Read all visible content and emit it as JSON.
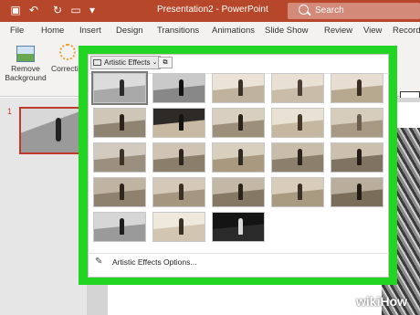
{
  "titlebar": {
    "title": "Presentation2  -  PowerPoint",
    "search_placeholder": "Search",
    "icons": [
      "save-icon",
      "undo-icon",
      "redo-icon",
      "present-icon",
      "more-icon"
    ]
  },
  "tabs": [
    "File",
    "Home",
    "Insert",
    "Design",
    "Transitions",
    "Animations",
    "Slide Show",
    "Review",
    "View",
    "Record"
  ],
  "ribbon": {
    "remove_background": "Remove Background",
    "corrections": "Correction"
  },
  "slide_panel": {
    "slide_number": "1"
  },
  "dropdown": {
    "button_label": "Artistic Effects",
    "options_label": "Artistic Effects Options...",
    "effects": [
      {
        "name": "none",
        "sky": "#dcdcdc",
        "ground": "#a9a9a9",
        "fig": "#2b2b2b",
        "selected": true
      },
      {
        "name": "marker",
        "sky": "#c9c9c9",
        "ground": "#888",
        "fig": "#111"
      },
      {
        "name": "pencil-grayscale",
        "sky": "#ebe3d7",
        "ground": "#bfb39e",
        "fig": "#3b3128"
      },
      {
        "name": "pencil-sketch",
        "sky": "#e8e0d2",
        "ground": "#c9bca8",
        "fig": "#4c3f33"
      },
      {
        "name": "line-drawing",
        "sky": "#e7ddd0",
        "ground": "#b7a890",
        "fig": "#3a2e22"
      },
      {
        "name": "chalk-sketch",
        "sky": "#cfc6b8",
        "ground": "#8f8472",
        "fig": "#2c241a"
      },
      {
        "name": "paint-strokes",
        "sky": "#2d2a27",
        "ground": "#c7b9a2",
        "fig": "#151210"
      },
      {
        "name": "paint-brush",
        "sky": "#d8cfc0",
        "ground": "#9d907b",
        "fig": "#2a2219"
      },
      {
        "name": "glow-diffused",
        "sky": "#e9e1d4",
        "ground": "#c5b7a0",
        "fig": "#453829"
      },
      {
        "name": "blur",
        "sky": "#d7cdbd",
        "ground": "#a89985",
        "fig": "#6b5d4d"
      },
      {
        "name": "light-screen",
        "sky": "#d2cabe",
        "ground": "#9b9080",
        "fig": "#3c3328"
      },
      {
        "name": "watercolor-sponge",
        "sky": "#cfc4b3",
        "ground": "#8b7e6b",
        "fig": "#2d251c"
      },
      {
        "name": "film-grain",
        "sky": "#d9cfbf",
        "ground": "#a8997f",
        "fig": "#322a20"
      },
      {
        "name": "mosaic-bubbles",
        "sky": "#c8bcaa",
        "ground": "#8c7f6c",
        "fig": "#2b2319"
      },
      {
        "name": "glass",
        "sky": "#cbbfae",
        "ground": "#7f7361",
        "fig": "#241d15"
      },
      {
        "name": "cement",
        "sky": "#bfb3a1",
        "ground": "#8e826f",
        "fig": "#2e261c"
      },
      {
        "name": "texturizer",
        "sky": "#d4c9b8",
        "ground": "#a4967f",
        "fig": "#3a3024"
      },
      {
        "name": "crisscross-etching",
        "sky": "#c3b7a5",
        "ground": "#857864",
        "fig": "#2a2218"
      },
      {
        "name": "pastels-smooth",
        "sky": "#d8cdbb",
        "ground": "#a99a82",
        "fig": "#3b3124"
      },
      {
        "name": "plastic-wrap",
        "sky": "#b9ad9b",
        "ground": "#7a6e5b",
        "fig": "#221b13"
      },
      {
        "name": "cutout",
        "sky": "#d6d6d6",
        "ground": "#9a9a9a",
        "fig": "#1d1d1d"
      },
      {
        "name": "photocopy",
        "sky": "#efe8dc",
        "ground": "#d2c6b2",
        "fig": "#3a3024"
      },
      {
        "name": "glow-edges",
        "sky": "#141414",
        "ground": "#2a2a2a",
        "fig": "#d9d9d9"
      }
    ]
  },
  "watermark": "wikiHow"
}
